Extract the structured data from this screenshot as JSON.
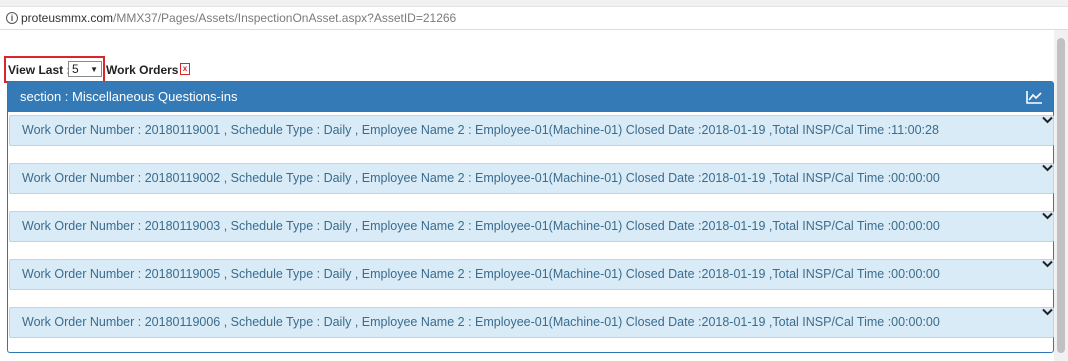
{
  "browser": {
    "url_domain": "proteusmmx.com",
    "url_path": "/MMX37/Pages/Assets/InspectionOnAsset.aspx?AssetID=21266",
    "info_icon": "i"
  },
  "filter": {
    "view_last_label": "View Last :",
    "selected_value": "5",
    "work_orders_label": "Work Orders",
    "export_icon": "pdf-icon"
  },
  "panel": {
    "title": "section : Miscellaneous Questions-ins",
    "chart_icon": "chart-icon"
  },
  "work_orders": [
    "Work Order Number : 20180119001 , Schedule Type : Daily , Employee Name 2 : Employee-01(Machine-01)  Closed Date :2018-01-19 ,Total INSP/Cal Time :11:00:28",
    "Work Order Number : 20180119002 , Schedule Type : Daily , Employee Name 2 : Employee-01(Machine-01)  Closed Date :2018-01-19 ,Total INSP/Cal Time :00:00:00",
    "Work Order Number : 20180119003 , Schedule Type : Daily , Employee Name 2 : Employee-01(Machine-01)  Closed Date :2018-01-19 ,Total INSP/Cal Time :00:00:00",
    "Work Order Number : 20180119005 , Schedule Type : Daily , Employee Name 2 : Employee-01(Machine-01)  Closed Date :2018-01-19 ,Total INSP/Cal Time :00:00:00",
    "Work Order Number : 20180119006 , Schedule Type : Daily , Employee Name 2 : Employee-01(Machine-01)  Closed Date :2018-01-19 ,Total INSP/Cal Time :00:00:00"
  ],
  "colors": {
    "panel_header": "#337ab7",
    "row_background": "#d9ebf6",
    "row_text": "#3b6c8d",
    "highlight_border": "#d9262c"
  }
}
